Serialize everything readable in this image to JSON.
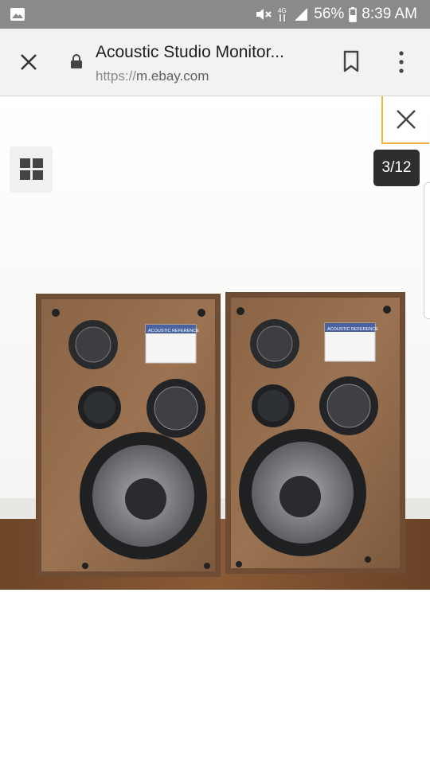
{
  "status_bar": {
    "battery": "56%",
    "time": "8:39 AM",
    "icons": [
      "image-notification-icon",
      "mute-icon",
      "data-4g-icon",
      "signal-icon",
      "battery-icon"
    ]
  },
  "browser": {
    "page_title": "Acoustic Studio Monitor...",
    "url_scheme": "https://",
    "url_host": "m.ebay.com",
    "icons": [
      "close-icon",
      "lock-icon",
      "bookmark-icon",
      "more-vert-icon"
    ]
  },
  "viewer": {
    "counter": "3/12",
    "speaker_label": "ACOUSTIC REFERENCE",
    "icons": [
      "close-icon",
      "grid-view-icon"
    ],
    "accent_color": "#f0b23a"
  }
}
